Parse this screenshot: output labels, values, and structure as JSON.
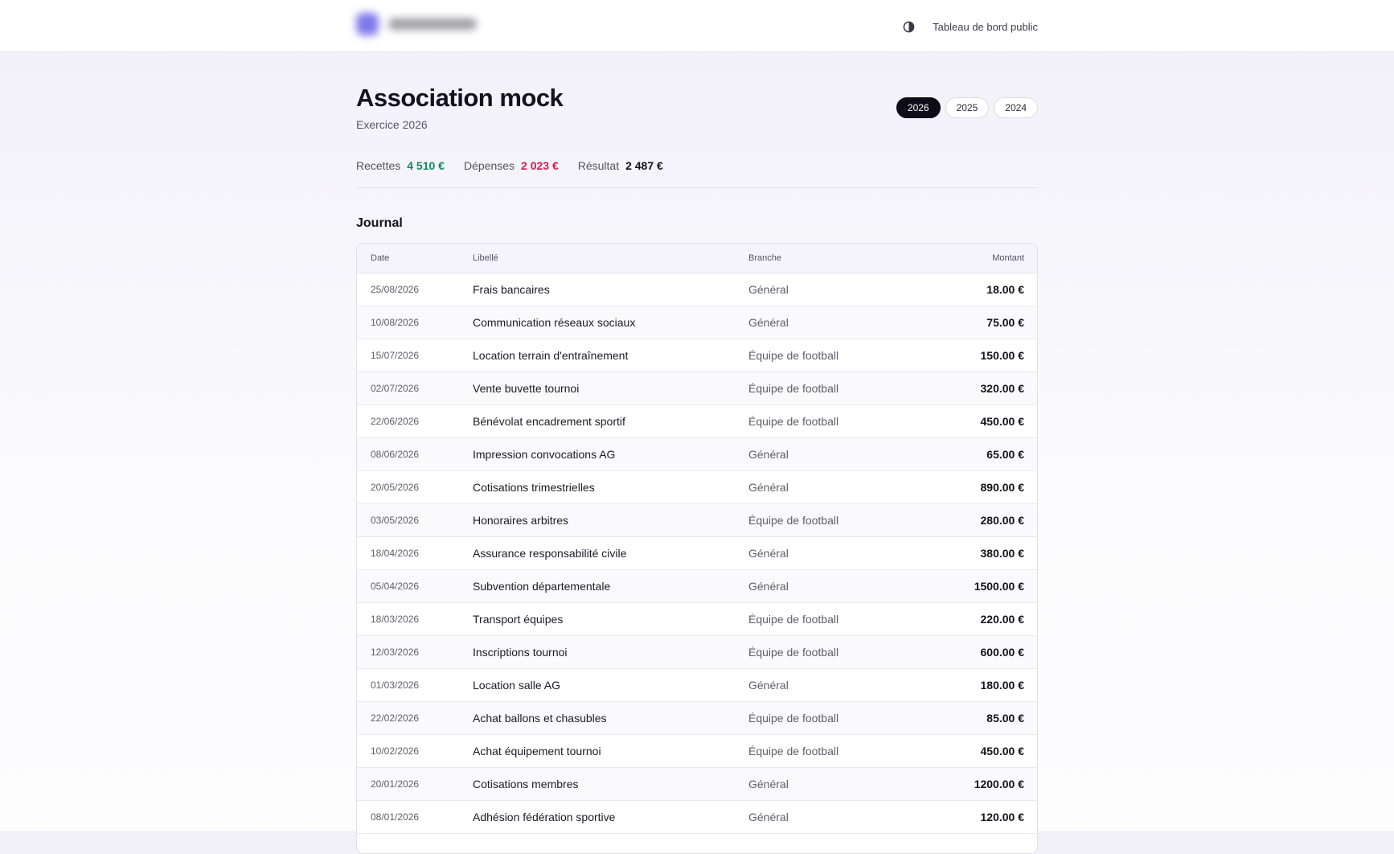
{
  "header": {
    "public_dashboard_label": "Tableau de bord public"
  },
  "page": {
    "title": "Association mock",
    "subtitle": "Exercice 2026",
    "years": [
      "2026",
      "2025",
      "2024"
    ],
    "active_year": "2026"
  },
  "stats": {
    "income_label": "Recettes",
    "income_value": "4 510 €",
    "expense_label": "Dépenses",
    "expense_value": "2 023 €",
    "result_label": "Résultat",
    "result_value": "2 487 €",
    "colors": {
      "income": "#0f8a5f",
      "expense": "#d9184e",
      "result": "#14121d"
    }
  },
  "journal": {
    "title": "Journal",
    "columns": {
      "date": "Date",
      "label": "Libellé",
      "branch": "Branche",
      "amount": "Montant"
    },
    "rows": [
      {
        "date": "25/08/2026",
        "label": "Frais bancaires",
        "branch": "Général",
        "amount": "18.00 €"
      },
      {
        "date": "10/08/2026",
        "label": "Communication réseaux sociaux",
        "branch": "Général",
        "amount": "75.00 €"
      },
      {
        "date": "15/07/2026",
        "label": "Location terrain d'entraînement",
        "branch": "Équipe de football",
        "amount": "150.00 €"
      },
      {
        "date": "02/07/2026",
        "label": "Vente buvette tournoi",
        "branch": "Équipe de football",
        "amount": "320.00 €"
      },
      {
        "date": "22/06/2026",
        "label": "Bénévolat encadrement sportif",
        "branch": "Équipe de football",
        "amount": "450.00 €"
      },
      {
        "date": "08/06/2026",
        "label": "Impression convocations AG",
        "branch": "Général",
        "amount": "65.00 €"
      },
      {
        "date": "20/05/2026",
        "label": "Cotisations trimestrielles",
        "branch": "Général",
        "amount": "890.00 €"
      },
      {
        "date": "03/05/2026",
        "label": "Honoraires arbitres",
        "branch": "Équipe de football",
        "amount": "280.00 €"
      },
      {
        "date": "18/04/2026",
        "label": "Assurance responsabilité civile",
        "branch": "Général",
        "amount": "380.00 €"
      },
      {
        "date": "05/04/2026",
        "label": "Subvention départementale",
        "branch": "Général",
        "amount": "1500.00 €"
      },
      {
        "date": "18/03/2026",
        "label": "Transport équipes",
        "branch": "Équipe de football",
        "amount": "220.00 €"
      },
      {
        "date": "12/03/2026",
        "label": "Inscriptions tournoi",
        "branch": "Équipe de football",
        "amount": "600.00 €"
      },
      {
        "date": "01/03/2026",
        "label": "Location salle AG",
        "branch": "Général",
        "amount": "180.00 €"
      },
      {
        "date": "22/02/2026",
        "label": "Achat ballons et chasubles",
        "branch": "Équipe de football",
        "amount": "85.00 €"
      },
      {
        "date": "10/02/2026",
        "label": "Achat équipement tournoi",
        "branch": "Équipe de football",
        "amount": "450.00 €"
      },
      {
        "date": "20/01/2026",
        "label": "Cotisations membres",
        "branch": "Général",
        "amount": "1200.00 €"
      },
      {
        "date": "08/01/2026",
        "label": "Adhésion fédération sportive",
        "branch": "Général",
        "amount": "120.00 €"
      }
    ]
  }
}
